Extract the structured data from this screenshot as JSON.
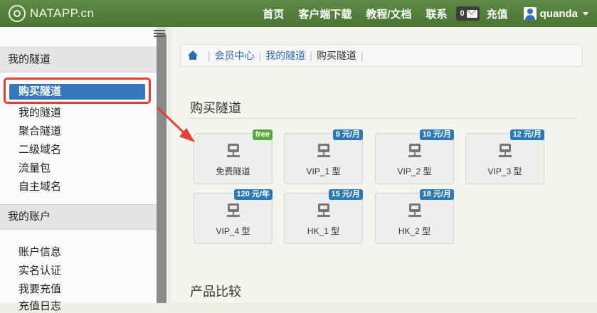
{
  "brand": {
    "name": "NATAPP.cn"
  },
  "nav": {
    "items": [
      "首页",
      "客户端下载",
      "教程/文档",
      "联系"
    ],
    "message_count": "0",
    "recharge": "充值",
    "username": "quanda"
  },
  "sidebar": {
    "section1": "我的隧道",
    "section1_items": [
      "购买隧道",
      "我的隧道",
      "聚合隧道",
      "二级域名",
      "流量包",
      "自主域名"
    ],
    "active_item": "购买隧道",
    "section2": "我的账户",
    "section2_items": [
      "账户信息",
      "实名认证",
      "我要充值",
      "充值日志"
    ]
  },
  "breadcrumb": {
    "items": [
      "会员中心",
      "我的隧道",
      "购买隧道"
    ]
  },
  "purchase": {
    "title": "购买隧道",
    "tiles": [
      {
        "label": "免费隧道",
        "badge": "free"
      },
      {
        "label": "VIP_1 型",
        "badge": "9 元/月"
      },
      {
        "label": "VIP_2 型",
        "badge": "10 元/月"
      },
      {
        "label": "VIP_3 型",
        "badge": "12 元/月"
      },
      {
        "label": "VIP_4 型",
        "badge": "120 元/年"
      },
      {
        "label": "HK_1 型",
        "badge": "15 元/月"
      },
      {
        "label": "HK_2 型",
        "badge": "18 元/月"
      }
    ]
  },
  "compare": {
    "title": "产品比较"
  },
  "colors": {
    "nav_green": "#4f7b39",
    "link_blue": "#2a6db0",
    "badge_blue": "#2a7ab8",
    "badge_green": "#5aaa3a",
    "highlight_red": "#e64032"
  }
}
